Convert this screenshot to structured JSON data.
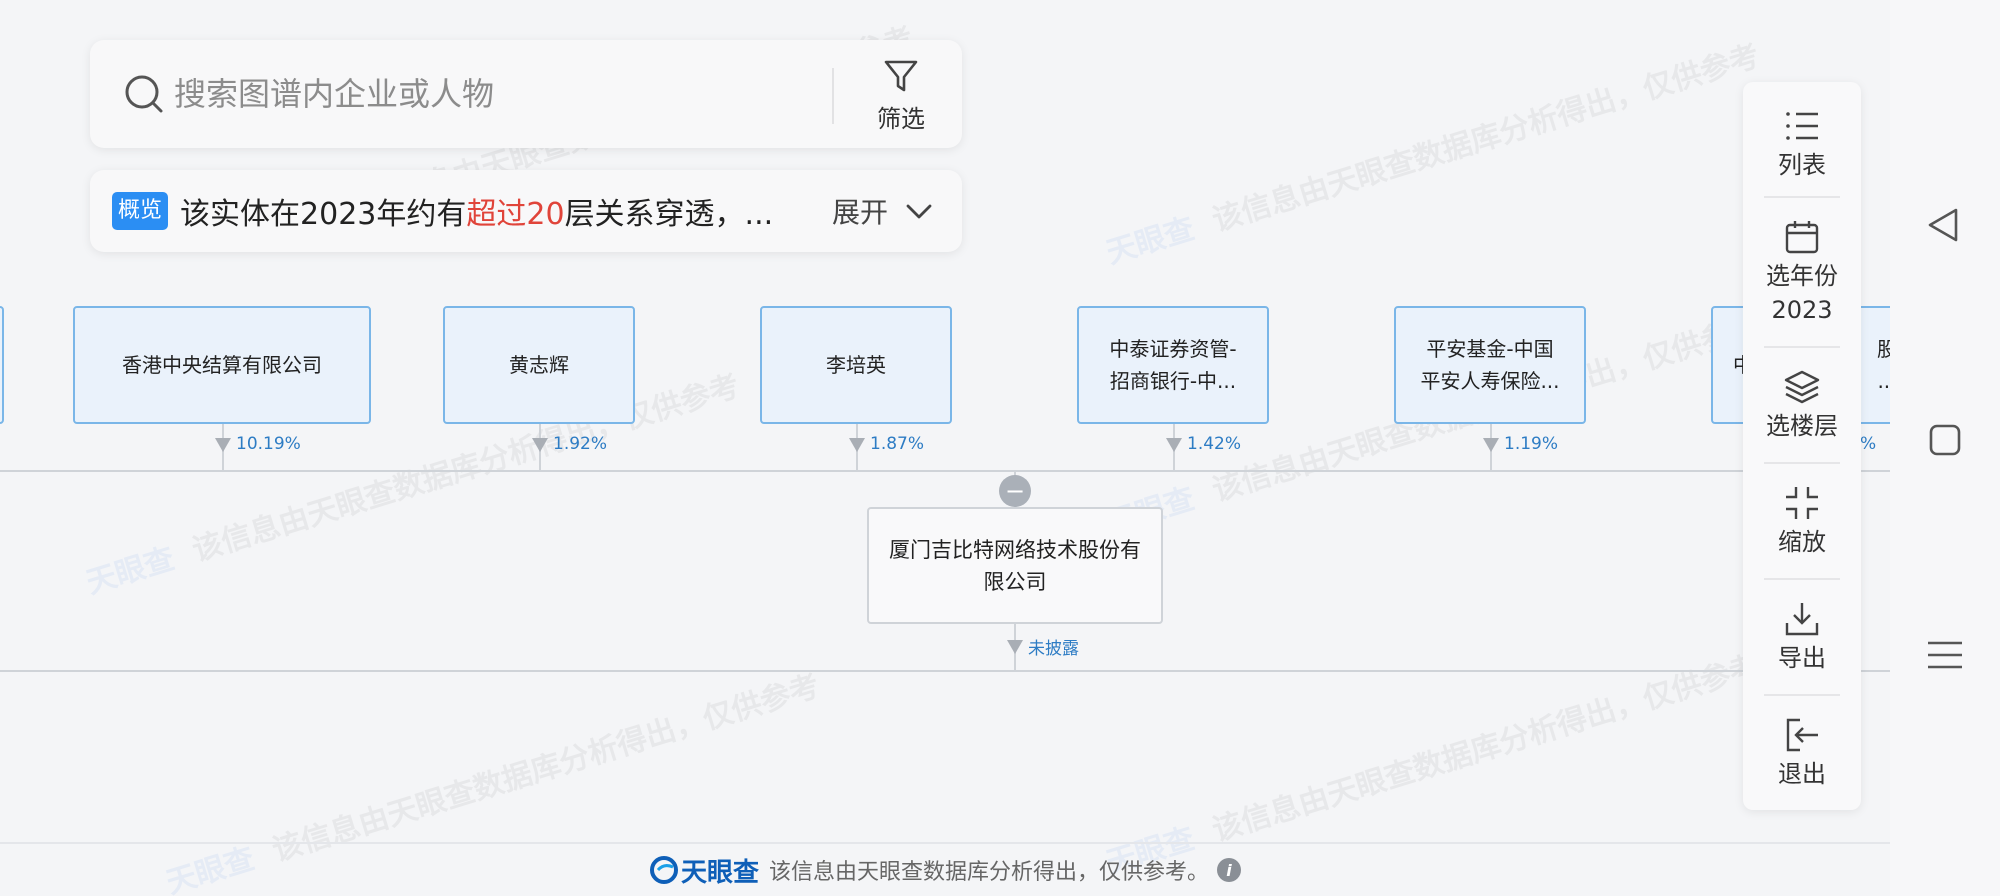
{
  "search": {
    "placeholder": "搜索图谱内企业或人物",
    "filter_label": "筛选"
  },
  "overview": {
    "badge": "概览",
    "text_before": "该实体在2023年约有",
    "text_highlight": "超过20",
    "text_after": "层关系穿透，...",
    "expand_label": "展开"
  },
  "shareholders": [
    {
      "name_line1": "香港中央结算有限公司",
      "name_line2": "",
      "percent": "10.19%"
    },
    {
      "name_line1": "黄志辉",
      "name_line2": "",
      "percent": "1.92%"
    },
    {
      "name_line1": "李培英",
      "name_line2": "",
      "percent": "1.87%"
    },
    {
      "name_line1": "中泰证券资管-",
      "name_line2": "招商银行-中...",
      "percent": "1.42%"
    },
    {
      "name_line1": "平安基金-中国",
      "name_line2": "平安人寿保险...",
      "percent": "1.19%"
    },
    {
      "name_line1": "中",
      "name_line2": "",
      "name_right": "股",
      "name_right2": "...",
      "percent": "%"
    }
  ],
  "center": {
    "name_line1": "厦门吉比特网络技术股份有",
    "name_line2": "限公司",
    "toggle": "−",
    "investment_label": "未披露"
  },
  "toolbar": {
    "list_label": "列表",
    "year_label": "选年份",
    "year_value": "2023",
    "layer_label": "选楼层",
    "zoom_label": "缩放",
    "export_label": "导出",
    "exit_label": "退出"
  },
  "footer": {
    "brand": "天眼查",
    "text": "该信息由天眼查数据库分析得出，仅供参考。",
    "info": "i"
  },
  "watermark": {
    "brand": "天眼查",
    "text": "该信息由天眼查数据库分析得出，仅供参考"
  },
  "colors": {
    "accent": "#2b8ef3",
    "highlight": "#e0443a",
    "node_border": "#7ab6e8",
    "node_fill": "#eaf2fb",
    "percent": "#2d7cc4"
  }
}
